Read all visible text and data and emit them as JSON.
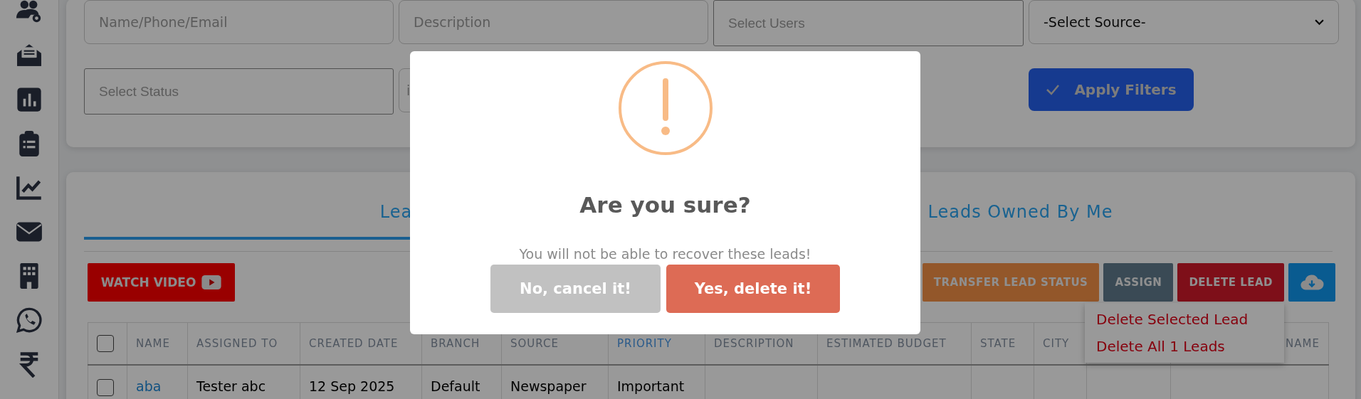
{
  "filters": {
    "fields": [
      {
        "kind": "input",
        "placeholder": "Name/Phone/Email"
      },
      {
        "kind": "input",
        "placeholder": "Description"
      },
      {
        "kind": "input",
        "placeholder": "Select Users"
      },
      {
        "kind": "select",
        "value": "-Select Source-"
      },
      {
        "kind": "input",
        "placeholder": "Select Status"
      },
      {
        "kind": "input",
        "placeholder": "i"
      }
    ],
    "apply_button": "Apply Filters"
  },
  "tabs": [
    {
      "label": "Lea",
      "selected": true
    },
    {
      "label": "Leads Owned By Me",
      "selected": false
    }
  ],
  "watch_video_button": "WATCH VIDEO",
  "toolbar_buttons": [
    {
      "kind": "transfer",
      "label": "TRANSFER LEAD STATUS"
    },
    {
      "kind": "assign",
      "label": "ASSIGN"
    },
    {
      "kind": "delete",
      "label": "DELETE LEAD"
    },
    {
      "kind": "download"
    }
  ],
  "delete_menu": [
    "Delete Selected Lead",
    "Delete All 1 Leads"
  ],
  "table": {
    "header_checked": false,
    "columns": [
      {
        "label": "NAME",
        "sorted": false
      },
      {
        "label": "ASSIGNED TO",
        "sorted": false
      },
      {
        "label": "CREATED DATE",
        "sorted": false
      },
      {
        "label": "BRANCH",
        "sorted": false
      },
      {
        "label": "SOURCE",
        "sorted": false
      },
      {
        "label": "PRIORITY",
        "sorted": true
      },
      {
        "label": "DESCRIPTION",
        "sorted": false
      },
      {
        "label": "ESTIMATED BUDGET",
        "sorted": false
      },
      {
        "label": "STATE",
        "sorted": false
      },
      {
        "label": "CITY",
        "sorted": false
      },
      {},
      {
        "label": "NAME",
        "sorted": false
      }
    ],
    "rows": [
      {
        "checked": false,
        "cells": [
          "aba",
          "Tester abc",
          "12 Sep 2025",
          "Default",
          "Newspaper",
          "Important"
        ]
      }
    ]
  },
  "dialog": {
    "title": "Are you sure?",
    "message": "You will not be able to recover these leads!",
    "buttons": [
      {
        "kind": "cancel",
        "label": "No, cancel it!"
      },
      {
        "kind": "confirm",
        "label": "Yes, delete it!"
      }
    ]
  }
}
